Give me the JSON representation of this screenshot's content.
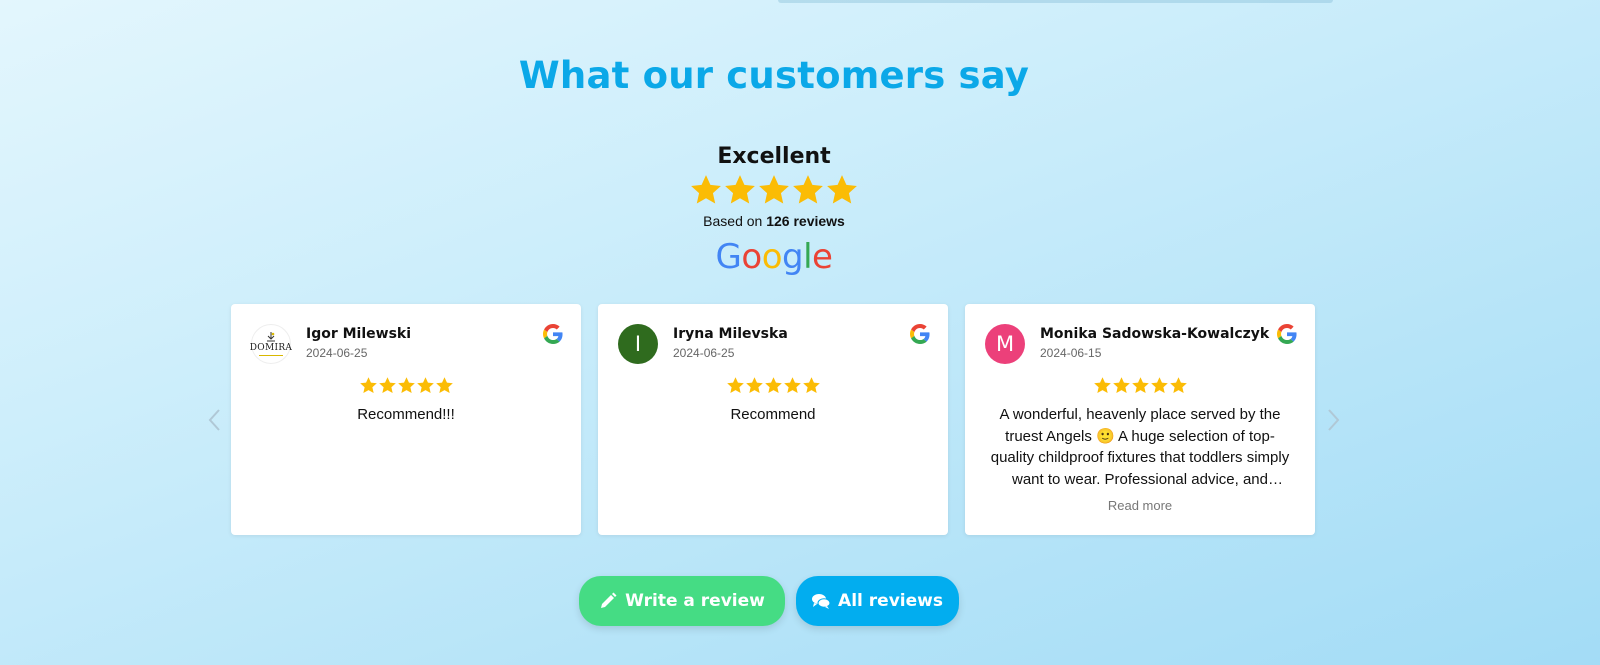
{
  "section": {
    "heading": "What our customers say"
  },
  "summary": {
    "rating_word": "Excellent",
    "stars": 5,
    "based_prefix": "Based on",
    "review_count_label": "126 reviews",
    "provider": "Google"
  },
  "colors": {
    "accent_blue": "#0ba8e8",
    "star": "#fbbc05",
    "write_button": "#45dc84",
    "all_button": "#02adef",
    "google_blue": "#4285f4",
    "google_red": "#ea4335",
    "google_yellow": "#fbbc05",
    "google_green": "#34a853"
  },
  "reviews": [
    {
      "name": "Igor Milewski",
      "date": "2024-06-25",
      "stars": 5,
      "text": "Recommend!!!",
      "avatar_type": "logo",
      "avatar_logo_text": "DOMIRA"
    },
    {
      "name": "Iryna Milevska",
      "date": "2024-06-25",
      "stars": 5,
      "text": "Recommend",
      "avatar_type": "initial",
      "avatar_initial": "I",
      "avatar_color": "#2f6b1e"
    },
    {
      "name": "Monika Sadowska-Kowalczyk",
      "date": "2024-06-15",
      "stars": 5,
      "text": "A wonderful, heavenly place served by the truest Angels 🙂 A huge selection of top-quality childproof fixtures that toddlers simply want to wear. Professional advice, and attention to every little detail.",
      "read_more": "Read more",
      "avatar_type": "initial",
      "avatar_initial": "M",
      "avatar_color": "#ec407a"
    }
  ],
  "buttons": {
    "write_review": "Write a review",
    "all_reviews": "All reviews"
  },
  "icons": {
    "write": "pencil-icon",
    "all": "chat-bubbles-icon",
    "prev": "chevron-left-icon",
    "next": "chevron-right-icon",
    "source": "google-g-icon"
  }
}
